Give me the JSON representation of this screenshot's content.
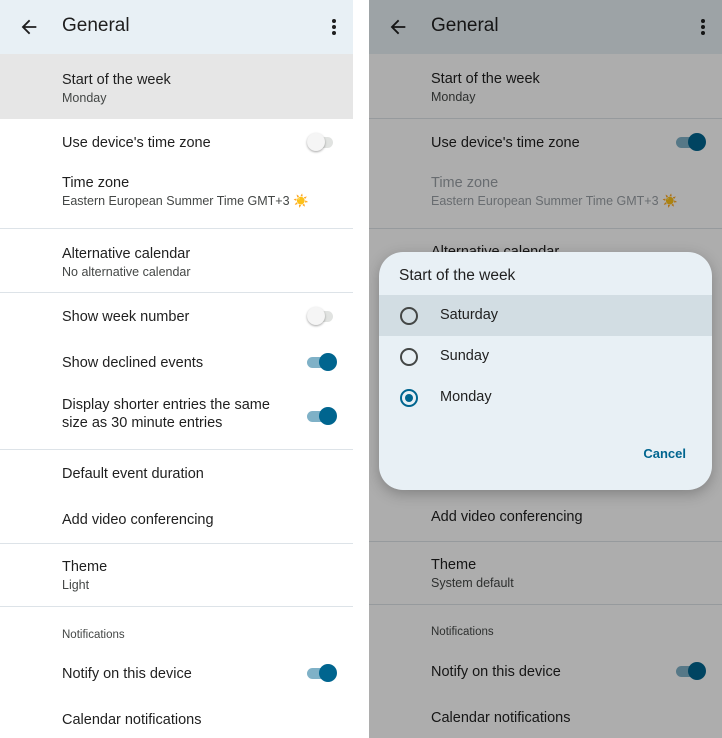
{
  "left": {
    "title": "General",
    "start_week": {
      "label": "Start of the week",
      "value": "Monday"
    },
    "device_tz": {
      "label": "Use device's time zone",
      "on": false
    },
    "time_zone": {
      "label": "Time zone",
      "value": "Eastern European Summer Time  GMT+3 ☀️"
    },
    "alt_calendar": {
      "label": "Alternative calendar",
      "value": "No alternative calendar"
    },
    "week_number": {
      "label": "Show week number",
      "on": false
    },
    "declined": {
      "label": "Show declined events",
      "on": true
    },
    "shorter_entries": {
      "label_line1": "Display shorter entries the same",
      "label_line2": "size as 30 minute entries",
      "on": true
    },
    "default_duration": {
      "label": "Default event duration"
    },
    "video_conf": {
      "label": "Add video conferencing"
    },
    "theme": {
      "label": "Theme",
      "value": "Light"
    },
    "notifications_header": "Notifications",
    "notify_device": {
      "label": "Notify on this device",
      "on": true
    },
    "calendar_notifications": {
      "label": "Calendar notifications"
    }
  },
  "right": {
    "title": "General",
    "start_week": {
      "label": "Start of the week",
      "value": "Monday"
    },
    "device_tz": {
      "label": "Use device's time zone",
      "on": true
    },
    "time_zone": {
      "label": "Time zone",
      "value": "Eastern European Summer Time  GMT+3 ☀️"
    },
    "alt_calendar": {
      "label": "Alternative calendar"
    },
    "video_conf": {
      "label": "Add video conferencing"
    },
    "theme": {
      "label": "Theme",
      "value": "System default"
    },
    "notifications_header": "Notifications",
    "notify_device": {
      "label": "Notify on this device",
      "on": true
    },
    "calendar_notifications": {
      "label": "Calendar notifications"
    },
    "dialog": {
      "title": "Start of the week",
      "options": [
        "Saturday",
        "Sunday",
        "Monday"
      ],
      "selected": "Monday",
      "cancel": "Cancel"
    }
  },
  "icons": {
    "back": "arrow-back-icon",
    "more": "more-vert-icon"
  },
  "colors": {
    "accent": "#00658f",
    "appbar": "#e8f0f5",
    "switch_track_on": "#7fb1c7"
  }
}
